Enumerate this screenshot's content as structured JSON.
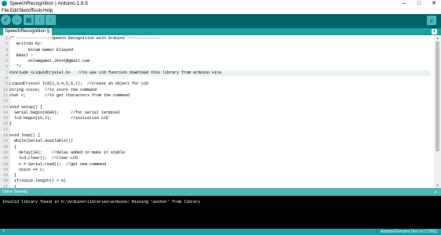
{
  "window": {
    "title": "SpeechRecognition | Arduino 1.8.5",
    "controls": [
      "–",
      "□",
      "✕"
    ]
  },
  "menu": [
    "File",
    "Edit",
    "Sketch",
    "Tools",
    "Help"
  ],
  "toolbar": {
    "verify": "✓",
    "upload": "→",
    "new": "▤",
    "open": "↑",
    "save": "↓",
    "serial_monitor": "⌕"
  },
  "tab": {
    "label": "SpeechRecognition §",
    "menu_arrow": "▾"
  },
  "code": [
    {
      "n": "1",
      "text": "/* ---------------Speech Recognition with Arduino --------------",
      "cls": "c-comment"
    },
    {
      "n": "2",
      "text": "   Written by:",
      "cls": "c-comment"
    },
    {
      "n": "3",
      "text": "        Eslam Gamal Elsayed",
      "cls": "c-comment"
    },
    {
      "n": "4",
      "text": "   Email :",
      "cls": "c-comment"
    },
    {
      "n": "5",
      "text": "        eslamgamal.2014l@gmail.com",
      "cls": "c-comment"
    },
    {
      "n": "6",
      "text": "   */",
      "cls": "c-comment"
    },
    {
      "n": "7",
      "text": "#include <LiquidCrystal.h>   //to use LCD function download this library from arduino site",
      "cls": ""
    },
    {
      "n": "8",
      "text": "",
      "cls": ""
    },
    {
      "n": "9",
      "text": "LiquidCrystal lcd(2,3,4,5,6,7);  //create an object for LCD",
      "cls": ""
    },
    {
      "n": "10",
      "text": "String voice;  //to store the command",
      "cls": ""
    },
    {
      "n": "11",
      "text": "char c;        //to get characters from the command",
      "cls": ""
    },
    {
      "n": "12",
      "text": "",
      "cls": ""
    },
    {
      "n": "13",
      "text": "void setup() {",
      "cls": ""
    },
    {
      "n": "14",
      "text": "  Serial.begin(9600);     //for serial terminal",
      "cls": ""
    },
    {
      "n": "15",
      "text": "  lcd.begin(16,2);        //initialize LCD",
      "cls": ""
    },
    {
      "n": "16",
      "text": "}",
      "cls": ""
    },
    {
      "n": "17",
      "text": "",
      "cls": ""
    },
    {
      "n": "18",
      "text": "void loop() {",
      "cls": ""
    },
    {
      "n": "19",
      "text": "  while(Serial.available())",
      "cls": ""
    },
    {
      "n": "20",
      "text": "  {",
      "cls": ""
    },
    {
      "n": "21",
      "text": "    delay(10);    //delay added to make it stable",
      "cls": ""
    },
    {
      "n": "22",
      "text": "    lcd.clear();  //clear LCD",
      "cls": ""
    },
    {
      "n": "23",
      "text": "    c = Serial.read();  //get new command",
      "cls": ""
    },
    {
      "n": "24",
      "text": "    voice += c;",
      "cls": ""
    },
    {
      "n": "25",
      "text": "  }",
      "cls": ""
    },
    {
      "n": "26",
      "text": "  if(voice.length() > 0)",
      "cls": ""
    },
    {
      "n": "27",
      "text": "  {",
      "cls": ""
    }
  ],
  "status": {
    "message": "Done Saving."
  },
  "console": {
    "output": "Invalid library found in D:\\Arduino\\libraries\\arduino: Missing 'author' from library"
  },
  "footer": {
    "line_number": "7",
    "board": "Arduino/Genuino Uno on COM11"
  },
  "colors": {
    "teal_dark": "#006468",
    "teal_mid": "#17a1a5",
    "teal_light": "#4db7bb",
    "comment": "#95a5a6",
    "keyword": "#728e00",
    "type": "#00979c",
    "func": "#d35400"
  }
}
